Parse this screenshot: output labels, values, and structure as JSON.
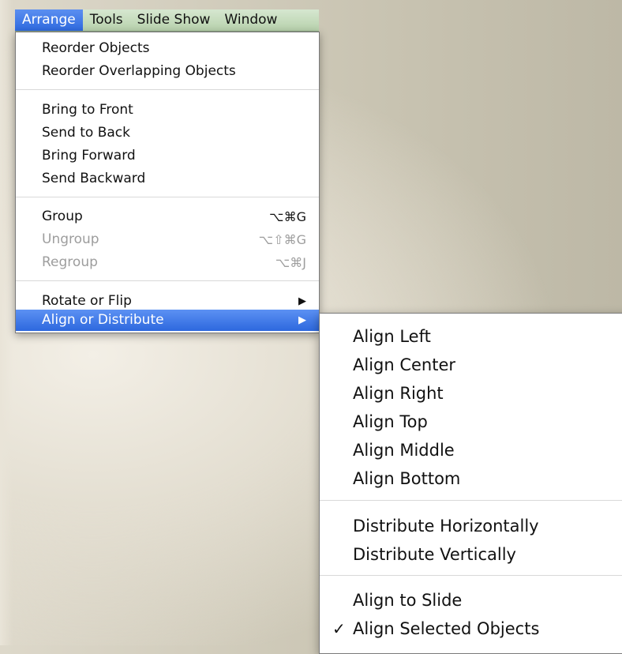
{
  "menubar": {
    "items": [
      {
        "label": "Arrange",
        "active": true
      },
      {
        "label": "Tools"
      },
      {
        "label": "Slide Show"
      },
      {
        "label": "Window"
      }
    ]
  },
  "arrange_menu": {
    "reorder_objects": "Reorder Objects",
    "reorder_overlapping": "Reorder Overlapping Objects",
    "bring_to_front": "Bring to Front",
    "send_to_back": "Send to Back",
    "bring_forward": "Bring Forward",
    "send_backward": "Send Backward",
    "group": {
      "label": "Group",
      "shortcut": "⌥⌘G"
    },
    "ungroup": {
      "label": "Ungroup",
      "shortcut": "⌥⇧⌘G",
      "disabled": true
    },
    "regroup": {
      "label": "Regroup",
      "shortcut": "⌥⌘J",
      "disabled": true
    },
    "rotate_or_flip": "Rotate or Flip",
    "align_or_distribute": "Align or Distribute",
    "submenu_arrow": "▶"
  },
  "align_submenu": {
    "align_left": "Align Left",
    "align_center": "Align Center",
    "align_right": "Align Right",
    "align_top": "Align Top",
    "align_middle": "Align Middle",
    "align_bottom": "Align Bottom",
    "distribute_horizontally": "Distribute Horizontally",
    "distribute_vertically": "Distribute Vertically",
    "align_to_slide": "Align to Slide",
    "align_selected_objects": "Align Selected Objects",
    "checkmark": "✓"
  },
  "colors": {
    "highlight": "#2f6ae0",
    "menubar_tint": "#b7d1ac",
    "disabled_text": "#9d9d9d"
  }
}
